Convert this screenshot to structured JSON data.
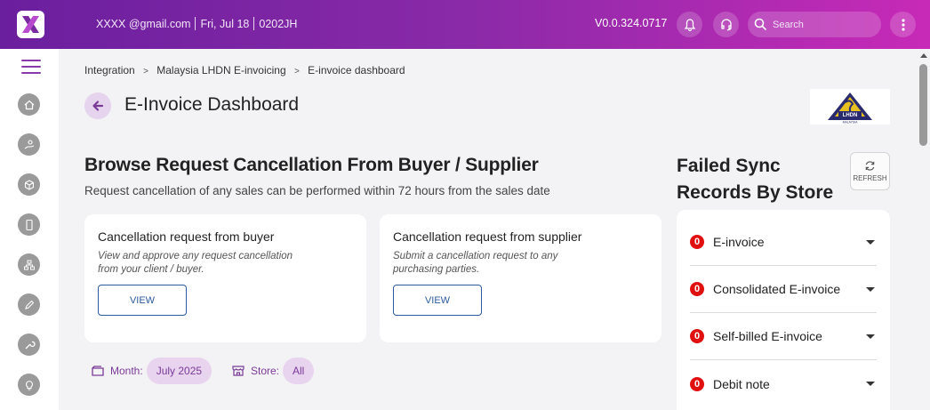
{
  "header": {
    "user_email": "XXXX @gmail.com",
    "date": "Fri, Jul 18",
    "code": "0202JH",
    "version": "V0.0.324.0717",
    "search_placeholder": "Search"
  },
  "breadcrumb": [
    "Integration",
    "Malaysia LHDN E-invoicing",
    "E-invoice dashboard"
  ],
  "breadcrumb_separator": ">",
  "page": {
    "title": "E-Invoice Dashboard"
  },
  "cancellation": {
    "title": "Browse Request Cancellation From Buyer / Supplier",
    "subtitle": "Request cancellation of any sales can be performed within 72 hours from the sales date",
    "cards": [
      {
        "title": "Cancellation request from buyer",
        "desc": "View and approve any request cancellation from your client / buyer.",
        "button": "VIEW"
      },
      {
        "title": "Cancellation request from supplier",
        "desc": "Submit a cancellation request to any purchasing parties.",
        "button": "VIEW"
      }
    ]
  },
  "filters": {
    "month_label": "Month:",
    "month_value": "July 2025",
    "store_label": "Store:",
    "store_value": "All"
  },
  "failed_sync": {
    "title": "Failed Sync Records By Store",
    "refresh_label": "REFRESH",
    "items": [
      {
        "count": "0",
        "label": "E-invoice"
      },
      {
        "count": "0",
        "label": "Consolidated E-invoice"
      },
      {
        "count": "0",
        "label": "Self-billed E-invoice"
      },
      {
        "count": "0",
        "label": "Debit note"
      }
    ]
  },
  "logo_text": "LHDN MALAYSIA",
  "colors": {
    "header_start": "#6a1f9e",
    "header_end": "#c72ab7",
    "accent": "#7a3a98",
    "badge": "#e01010",
    "button_border": "#2d5b9e"
  }
}
